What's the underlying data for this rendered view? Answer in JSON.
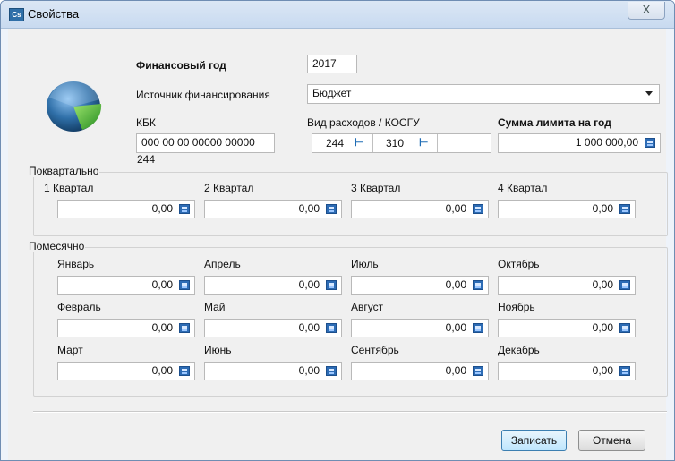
{
  "window": {
    "title": "Свойства",
    "close_symbol": "X"
  },
  "form": {
    "fiscal_year_label": "Финансовый год",
    "fiscal_year_value": "2017",
    "funding_source_label": "Источник финансирования",
    "funding_source_value": "Бюджет",
    "kbk_label": "КБК",
    "kbk_value": "000 00 00 00000 00000 244",
    "expense_kosgu_label": "Вид расходов / КОСГУ",
    "expense_type_value": "244",
    "kosgu_value": "310",
    "annual_limit_label": "Сумма лимита на год",
    "annual_limit_value": "1 000 000,00"
  },
  "quarterly": {
    "title": "Поквартально",
    "items": [
      {
        "label": "1 Квартал",
        "value": "0,00"
      },
      {
        "label": "2 Квартал",
        "value": "0,00"
      },
      {
        "label": "3 Квартал",
        "value": "0,00"
      },
      {
        "label": "4 Квартал",
        "value": "0,00"
      }
    ]
  },
  "monthly": {
    "title": "Помесячно",
    "months": [
      {
        "label": "Январь",
        "value": "0,00"
      },
      {
        "label": "Апрель",
        "value": "0,00"
      },
      {
        "label": "Июль",
        "value": "0,00"
      },
      {
        "label": "Октябрь",
        "value": "0,00"
      },
      {
        "label": "Февраль",
        "value": "0,00"
      },
      {
        "label": "Май",
        "value": "0,00"
      },
      {
        "label": "Август",
        "value": "0,00"
      },
      {
        "label": "Ноябрь",
        "value": "0,00"
      },
      {
        "label": "Март",
        "value": "0,00"
      },
      {
        "label": "Июнь",
        "value": "0,00"
      },
      {
        "label": "Сентябрь",
        "value": "0,00"
      },
      {
        "label": "Декабрь",
        "value": "0,00"
      }
    ]
  },
  "buttons": {
    "save": "Записать",
    "cancel": "Отмена"
  },
  "icons": {
    "app": "app-icon",
    "chart": "pie-chart-icon",
    "calculator": "calculator-icon",
    "tree": "tree-picker-icon",
    "dropdown": "chevron-down-icon"
  },
  "colors": {
    "accent": "#2d6cb5",
    "chart_blue": "#2f6fa8",
    "chart_green": "#43b52c"
  }
}
